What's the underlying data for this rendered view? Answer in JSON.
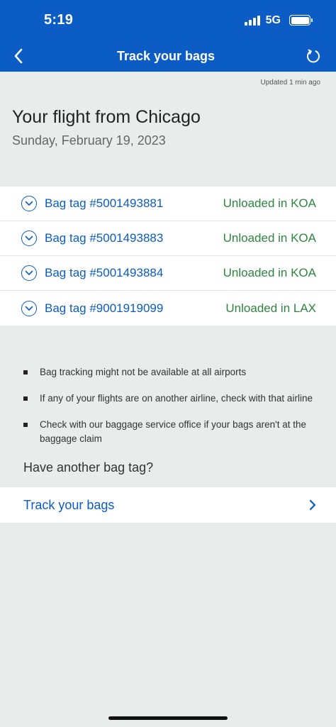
{
  "status_bar": {
    "time": "5:19",
    "network": "5G",
    "icons": [
      "signal-bars-icon",
      "battery-icon"
    ]
  },
  "nav": {
    "title": "Track your bags",
    "back_icon": "chevron-left-icon",
    "refresh_icon": "refresh-icon"
  },
  "updated_text": "Updated 1 min ago",
  "flight": {
    "title": "Your flight from Chicago",
    "date": "Sunday, February 19, 2023"
  },
  "bags": [
    {
      "tag": "Bag tag #5001493881",
      "status": "Unloaded in KOA"
    },
    {
      "tag": "Bag tag #5001493883",
      "status": "Unloaded in KOA"
    },
    {
      "tag": "Bag tag #5001493884",
      "status": "Unloaded in KOA"
    },
    {
      "tag": "Bag tag #9001919099",
      "status": "Unloaded in LAX"
    }
  ],
  "notes": [
    "Bag tracking might not be available at all airports",
    "If any of your flights are on another airline, check with that airline",
    "Check with our baggage service office if your bags aren't at the baggage claim"
  ],
  "another_tag": {
    "heading": "Have another bag tag?",
    "link_label": "Track your bags"
  },
  "colors": {
    "brand_blue": "#0b5cc5",
    "status_green": "#2e8540",
    "background": "#e8eceb"
  }
}
